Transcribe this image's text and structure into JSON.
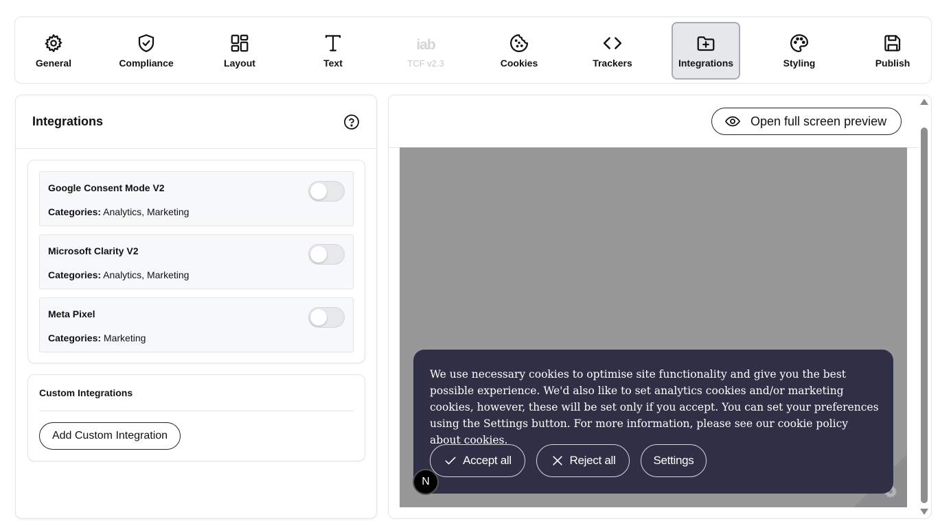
{
  "nav": {
    "tabs": [
      {
        "id": "general",
        "label": "General",
        "icon": "gear-icon"
      },
      {
        "id": "compliance",
        "label": "Compliance",
        "icon": "shield-check-icon"
      },
      {
        "id": "layout",
        "label": "Layout",
        "icon": "layout-grid-icon"
      },
      {
        "id": "text",
        "label": "Text",
        "icon": "text-icon"
      },
      {
        "id": "tcf",
        "label": "TCF v2.3",
        "icon": "iab-icon",
        "glyph": "iab",
        "disabled": true
      },
      {
        "id": "cookies",
        "label": "Cookies",
        "icon": "cookie-icon"
      },
      {
        "id": "trackers",
        "label": "Trackers",
        "icon": "code-icon"
      },
      {
        "id": "integrations",
        "label": "Integrations",
        "icon": "folder-plus-icon",
        "active": true
      },
      {
        "id": "styling",
        "label": "Styling",
        "icon": "palette-icon"
      },
      {
        "id": "publish",
        "label": "Publish",
        "icon": "save-icon"
      }
    ]
  },
  "integrations": {
    "title": "Integrations",
    "categories_key": "Categories:",
    "items": [
      {
        "name": "Google Consent Mode V2",
        "categories": "Analytics, Marketing",
        "enabled": false
      },
      {
        "name": "Microsoft Clarity V2",
        "categories": "Analytics, Marketing",
        "enabled": false
      },
      {
        "name": "Meta Pixel",
        "categories": "Marketing",
        "enabled": false
      }
    ]
  },
  "custom": {
    "title": "Custom Integrations",
    "add_label": "Add Custom Integration"
  },
  "preview": {
    "open_label": "Open full screen preview",
    "banner_text": "We use necessary cookies to optimise site functionality and give you the best possible experience. We'd also like to set analytics cookies and/or marketing cookies, however, these will be set only if you accept. You can set your preferences using the Settings button. For more information, please see our cookie policy about cookies.",
    "accept_label": "Accept all",
    "reject_label": "Reject all",
    "settings_label": "Settings",
    "badge_letter": "N"
  },
  "colors": {
    "banner_bg": "#2f2f45",
    "canvas_bg": "#989898",
    "active_tab_bg": "#e6e7ea"
  }
}
